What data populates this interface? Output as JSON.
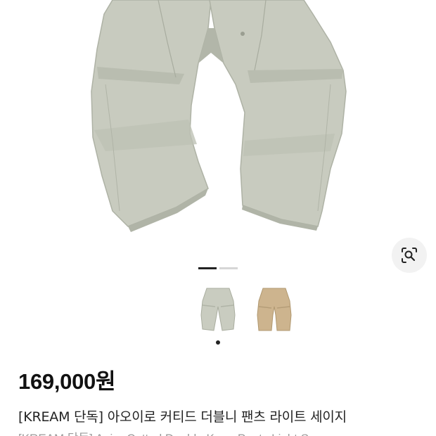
{
  "product": {
    "price": "169,000원",
    "title": "[KREAM 단독] 아오이로 커티드 더블니 팬츠 라이트 세이지",
    "subtitle": "[KREAM 단독] Aoiro Cutted Double Knee Pants Light Sage"
  },
  "gallery": {
    "current_index": 1,
    "total": 2,
    "thumbnails": [
      {
        "name": "light-sage-pants-thumbnail",
        "color": "#c9ccc0"
      },
      {
        "name": "beige-pants-thumbnail",
        "color": "#cdb48e"
      }
    ]
  },
  "icons": {
    "image_search": "lens-search-icon"
  },
  "colors": {
    "pants_main": "#c8cbbf",
    "pants_shadow": "#b2b6a9",
    "pants_beige": "#cbb18a",
    "indicator_active": "#222222",
    "indicator_inactive": "#d6d6d6"
  }
}
